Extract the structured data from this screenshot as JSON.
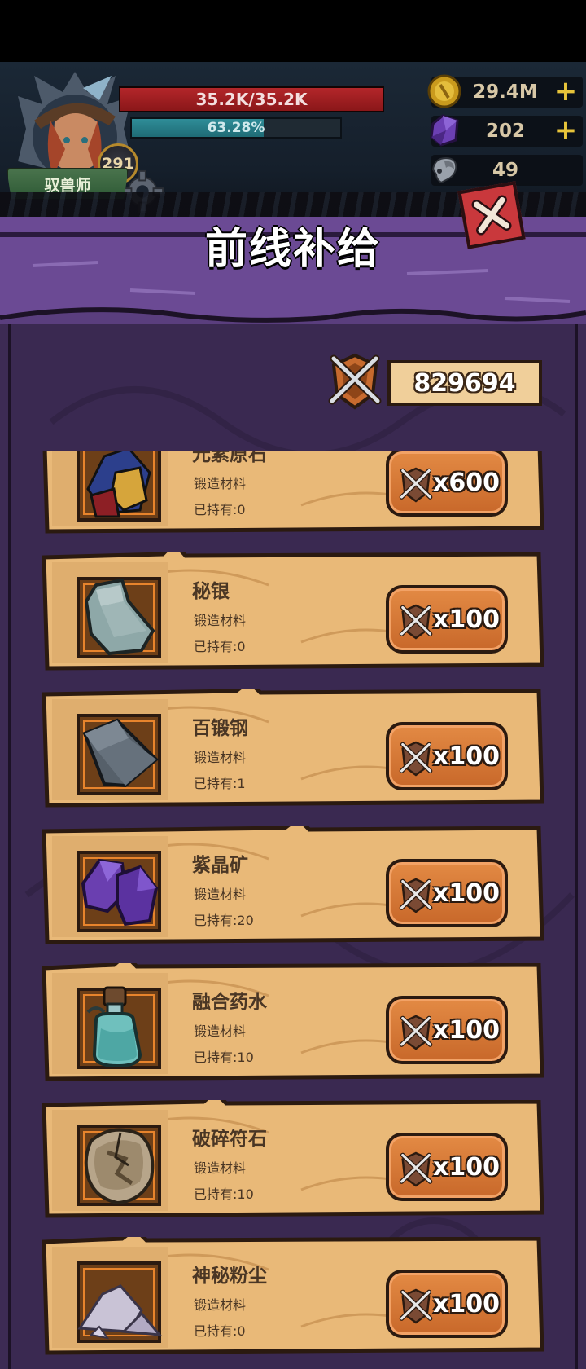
{
  "player": {
    "class_name": "驭兽师",
    "level": "291",
    "hp_text": "35.2K/35.2K",
    "hp_fraction": 1.0,
    "xp_text": "63.28%",
    "xp_fraction": 0.6328
  },
  "resources": [
    {
      "icon": "gold-coin-icon",
      "value": "29.4M",
      "has_plus": true
    },
    {
      "icon": "purple-gem-icon",
      "value": "202",
      "has_plus": true
    },
    {
      "icon": "ram-skull-icon",
      "value": "49",
      "has_plus": false
    }
  ],
  "panel": {
    "title": "前线补给",
    "currency_icon": "crossed-swords-medal-icon",
    "currency_value": "829694"
  },
  "items": [
    {
      "name": "元素原石",
      "type": "锻造材料",
      "owned": "已持有:0",
      "price": "x600",
      "icon": "elemental-ore-icon"
    },
    {
      "name": "秘银",
      "type": "锻造材料",
      "owned": "已持有:0",
      "price": "x100",
      "icon": "mithril-ingot-icon"
    },
    {
      "name": "百锻钢",
      "type": "锻造材料",
      "owned": "已持有:1",
      "price": "x100",
      "icon": "steel-ingot-icon"
    },
    {
      "name": "紫晶矿",
      "type": "锻造材料",
      "owned": "已持有:20",
      "price": "x100",
      "icon": "amethyst-ore-icon"
    },
    {
      "name": "融合药水",
      "type": "锻造材料",
      "owned": "已持有:10",
      "price": "x100",
      "icon": "fusion-potion-icon"
    },
    {
      "name": "破碎符石",
      "type": "锻造材料",
      "owned": "已持有:10",
      "price": "x100",
      "icon": "broken-runestone-icon"
    },
    {
      "name": "神秘粉尘",
      "type": "锻造材料",
      "owned": "已持有:0",
      "price": "x100",
      "icon": "mystic-dust-icon"
    }
  ],
  "colors": {
    "panel_purple": "#3d2b54",
    "card_parchment": "#e9b978",
    "button_orange": "#d87634",
    "hp_red": "#b3262a",
    "xp_teal": "#2f8d98"
  }
}
